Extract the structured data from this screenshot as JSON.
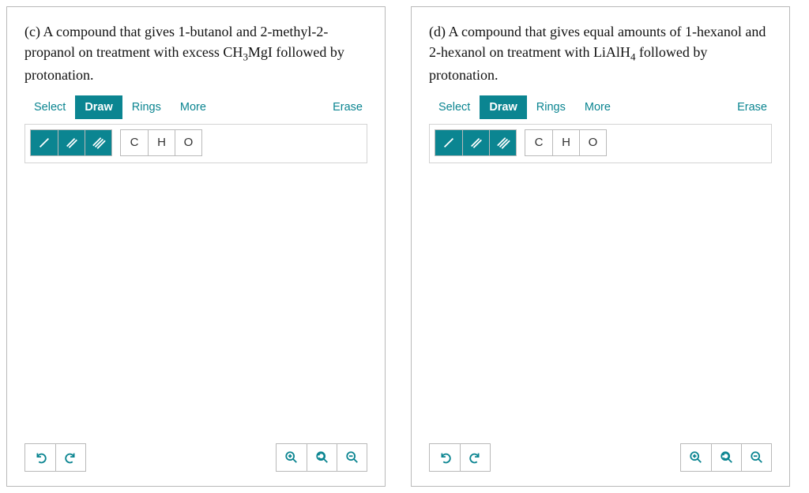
{
  "panels": [
    {
      "prompt_html": "(c) A compound that gives 1-butanol and 2-methyl-2-propanol on treatment with excess CH<sub>3</sub>MgI followed by protonation.",
      "tabs": {
        "select": "Select",
        "draw": "Draw",
        "rings": "Rings",
        "more": "More",
        "erase": "Erase"
      },
      "atoms": {
        "c": "C",
        "h": "H",
        "o": "O"
      }
    },
    {
      "prompt_html": "(d) A compound that gives equal amounts of 1-hexanol and 2-hexanol on treatment with LiAlH<sub>4</sub> followed by protonation.",
      "tabs": {
        "select": "Select",
        "draw": "Draw",
        "rings": "Rings",
        "more": "More",
        "erase": "Erase"
      },
      "atoms": {
        "c": "C",
        "h": "H",
        "o": "O"
      }
    }
  ],
  "icons": {
    "single_bond": "single-bond-icon",
    "double_bond": "double-bond-icon",
    "triple_bond": "triple-bond-icon",
    "undo": "undo-icon",
    "redo": "redo-icon",
    "zoom_in": "zoom-in-icon",
    "zoom_reset": "zoom-reset-icon",
    "zoom_out": "zoom-out-icon"
  }
}
